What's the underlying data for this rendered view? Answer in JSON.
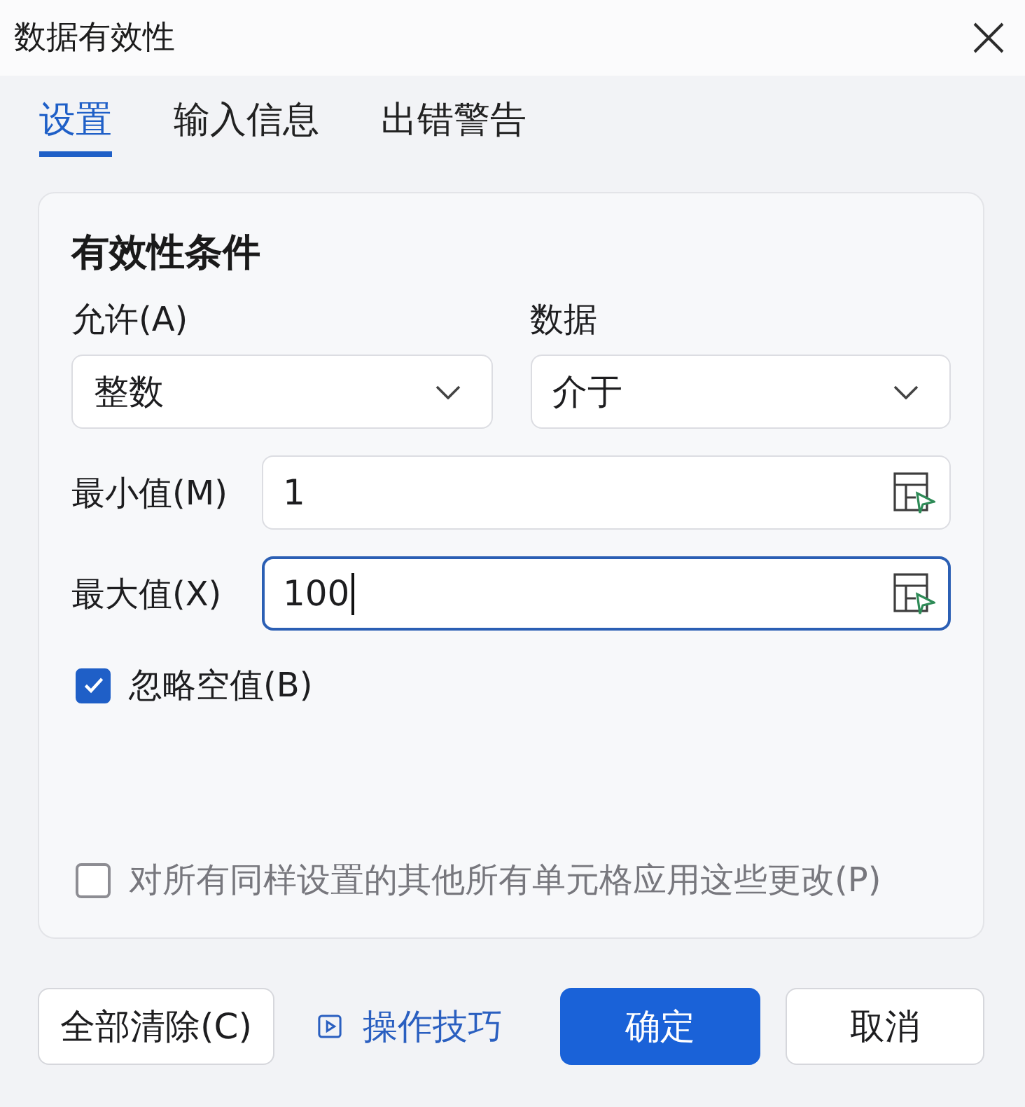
{
  "window": {
    "title": "数据有效性"
  },
  "tabs": [
    {
      "label": "设置",
      "selected": true
    },
    {
      "label": "输入信息",
      "selected": false
    },
    {
      "label": "出错警告",
      "selected": false
    }
  ],
  "validation": {
    "heading": "有效性条件",
    "allow": {
      "label": "允许(A)",
      "value": "整数"
    },
    "data": {
      "label": "数据",
      "value": "介于"
    },
    "fields": [
      {
        "label": "最小值(M)",
        "value": "1",
        "focused": false
      },
      {
        "label": "最大值(X)",
        "value": "100",
        "focused": true
      }
    ],
    "checkboxes": [
      {
        "label": "忽略空值(B)",
        "checked": true,
        "disabled": false
      },
      {
        "label": "对所有同样设置的其他所有单元格应用这些更改(P)",
        "checked": false,
        "disabled": true
      }
    ]
  },
  "buttons": [
    {
      "label": "全部清除(C)",
      "kind": "default"
    },
    {
      "label": "操作技巧",
      "kind": "link"
    },
    {
      "label": "确定",
      "kind": "primary"
    },
    {
      "label": "取消",
      "kind": "default"
    }
  ]
}
